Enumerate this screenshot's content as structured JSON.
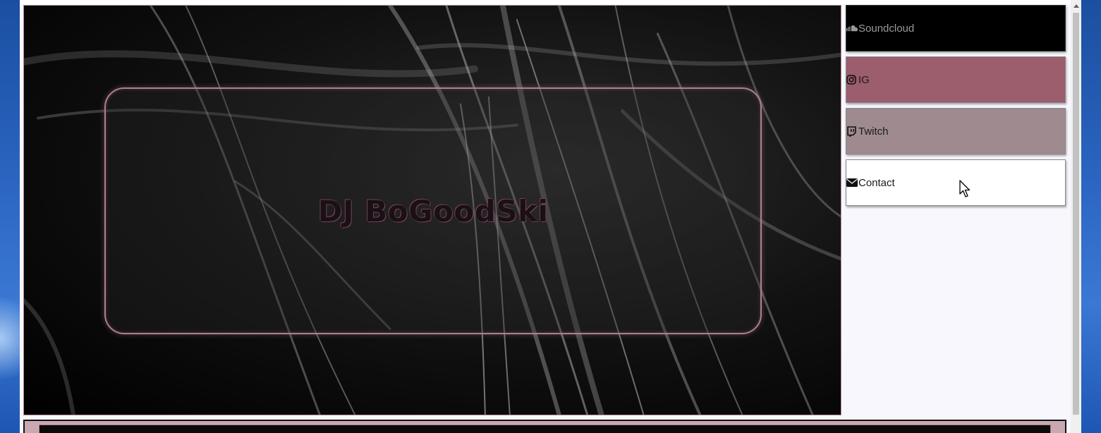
{
  "hero": {
    "title": "DJ BoGoodSki"
  },
  "nav": {
    "items": [
      {
        "label": "Soundcloud",
        "icon": "soundcloud-icon"
      },
      {
        "label": "IG",
        "icon": "instagram-icon"
      },
      {
        "label": "Twitch",
        "icon": "twitch-icon"
      },
      {
        "label": "Contact",
        "icon": "envelope-icon"
      }
    ]
  },
  "colors": {
    "soundcloud_bg": "#000000",
    "ig_bg": "#9c5d6c",
    "twitch_bg": "#9f8a90",
    "contact_bg": "#ffffff",
    "accent_border": "#b07e8e"
  }
}
